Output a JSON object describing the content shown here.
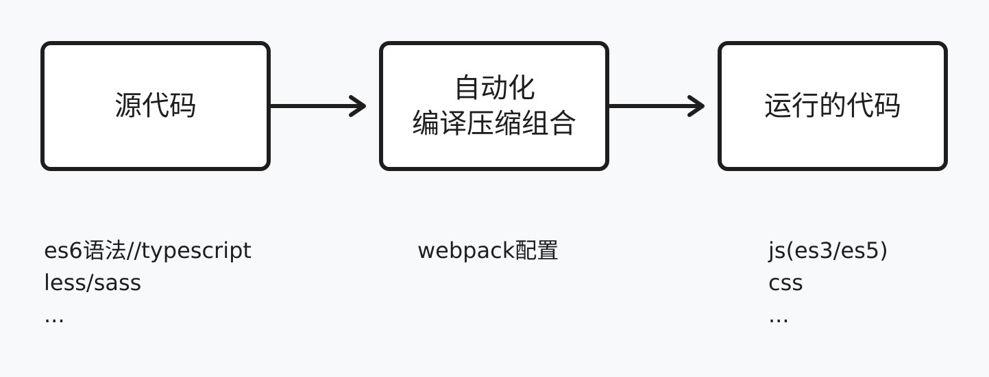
{
  "boxes": [
    {
      "lines": [
        "源代码"
      ]
    },
    {
      "lines": [
        "自动化",
        "编译压缩组合"
      ]
    },
    {
      "lines": [
        "运行的代码"
      ]
    }
  ],
  "notes": [
    {
      "lines": [
        "es6语法//typescript",
        "less/sass",
        "..."
      ]
    },
    {
      "lines": [
        "webpack配置"
      ]
    },
    {
      "lines": [
        "js(es3/es5)",
        "css",
        "..."
      ]
    }
  ],
  "colors": {
    "stroke": "#1e1e1e",
    "background": "#f8f9fa",
    "box_fill": "#ffffff"
  }
}
